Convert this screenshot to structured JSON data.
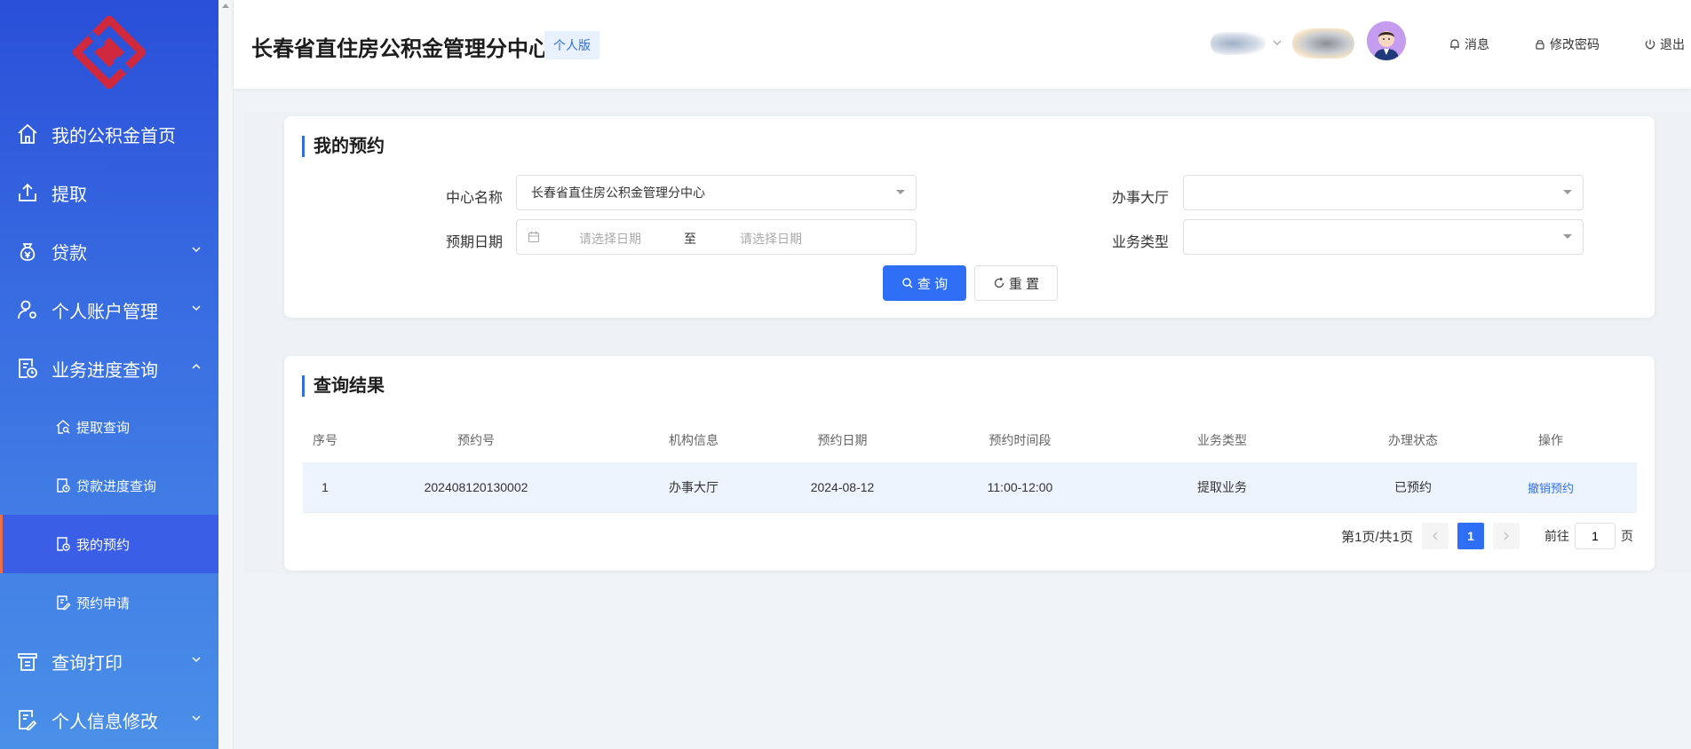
{
  "sidebar": {
    "items": [
      {
        "label": "我的公积金首页",
        "icon": "home-icon"
      },
      {
        "label": "提取",
        "icon": "upload-icon"
      },
      {
        "label": "贷款",
        "icon": "money-bag-icon",
        "expandable": true
      },
      {
        "label": "个人账户管理",
        "icon": "user-settings-icon",
        "expandable": true
      },
      {
        "label": "业务进度查询",
        "icon": "document-clock-icon",
        "expandable": true,
        "expanded": true
      }
    ],
    "subitems": [
      {
        "label": "提取查询",
        "icon": "house-search-icon"
      },
      {
        "label": "贷款进度查询",
        "icon": "document-clock-icon"
      },
      {
        "label": "我的预约",
        "icon": "document-clock-icon",
        "active": true
      },
      {
        "label": "预约申请",
        "icon": "edit-document-icon"
      }
    ],
    "bottom_items": [
      {
        "label": "查询打印",
        "icon": "printer-icon",
        "expandable": true
      },
      {
        "label": "个人信息修改",
        "icon": "edit-document-icon",
        "expandable": true
      }
    ]
  },
  "header": {
    "title": "长春省直住房公积金管理分中心",
    "badge": "个人版",
    "links": {
      "messages": "消息",
      "change_password": "修改密码",
      "logout": "退出"
    }
  },
  "reservation_card": {
    "title": "我的预约",
    "center_label": "中心名称",
    "center_value": "长春省直住房公积金管理分中心",
    "hall_label": "办事大厅",
    "hall_value": "",
    "date_label": "预期日期",
    "date_start_placeholder": "请选择日期",
    "date_separator": "至",
    "date_end_placeholder": "请选择日期",
    "type_label": "业务类型",
    "type_value": "",
    "query_button": "查 询",
    "reset_button": "重 置"
  },
  "results_card": {
    "title": "查询结果",
    "columns": [
      "序号",
      "预约号",
      "机构信息",
      "预约日期",
      "预约时间段",
      "业务类型",
      "办理状态",
      "操作"
    ],
    "rows": [
      {
        "index": "1",
        "reservation_no": "202408120130002",
        "org": "办事大厅",
        "date": "2024-08-12",
        "time_slot": "11:00-12:00",
        "business_type": "提取业务",
        "status": "已预约",
        "action": "撤销预约"
      }
    ],
    "pager": {
      "summary": "第1页/共1页",
      "current_page": "1",
      "goto_label": "前往",
      "goto_value": "1",
      "page_suffix": "页"
    }
  },
  "colors": {
    "primary": "#2f6ff5",
    "sidebar_top": "#2a4fd9",
    "sidebar_bottom": "#4a8fe8",
    "active_marker": "#f06d4a",
    "logo_red": "#d0283c"
  }
}
